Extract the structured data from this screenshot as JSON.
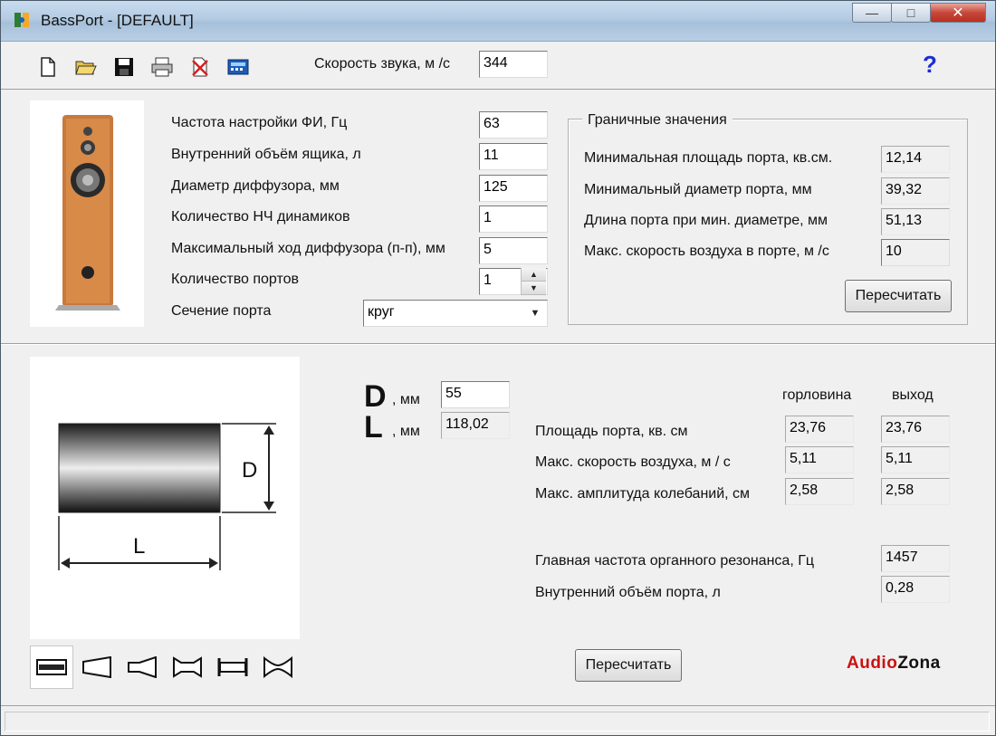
{
  "window": {
    "title": "BassPort - [DEFAULT]",
    "controls": {
      "minimize": "—",
      "maximize": "□",
      "close": "✕"
    }
  },
  "toolbar": {
    "icons": [
      "new-file-icon",
      "open-folder-icon",
      "save-icon",
      "print-icon",
      "delete-icon",
      "calculator-icon"
    ],
    "sound_speed_label": "Скорость звука, м /с",
    "sound_speed_value": "344",
    "help_label": "?"
  },
  "params": {
    "tuning_freq_label": "Частота настройки ФИ, Гц",
    "tuning_freq_value": "63",
    "box_volume_label": "Внутренний объём ящика, л",
    "box_volume_value": "11",
    "cone_diameter_label": "Диаметр диффузора, мм",
    "cone_diameter_value": "125",
    "woofer_count_label": "Количество НЧ динамиков",
    "woofer_count_value": "1",
    "max_excursion_label": "Максимальный ход диффузора (п-п), мм",
    "max_excursion_value": "5",
    "port_count_label": "Количество портов",
    "port_count_value": "1",
    "port_section_label": "Сечение порта",
    "port_section_value": "круг"
  },
  "limits": {
    "title": "Граничные значения",
    "min_area_label": "Минимальная площадь порта, кв.см.",
    "min_area_value": "12,14",
    "min_diameter_label": "Минимальный диаметр порта, мм",
    "min_diameter_value": "39,32",
    "length_at_min_label": "Длина порта при мин. диаметре, мм",
    "length_at_min_value": "51,13",
    "max_air_speed_label": "Макс. скорость воздуха в порте, м /с",
    "max_air_speed_value": "10",
    "recalc_label": "Пересчитать"
  },
  "port": {
    "d_letter": "D",
    "d_unit": ", мм",
    "d_value": "55",
    "l_letter": "L",
    "l_unit": ", мм",
    "l_value": "118,02",
    "diagram_d": "D",
    "diagram_l": "L"
  },
  "results": {
    "col_throat": "горловина",
    "col_exit": "выход",
    "area_label": "Площадь порта, кв. см",
    "area_throat": "23,76",
    "area_exit": "23,76",
    "air_speed_label": "Макс. скорость воздуха, м / с",
    "air_speed_throat": "5,11",
    "air_speed_exit": "5,11",
    "amplitude_label": "Макс. амплитуда колебаний, см",
    "amplitude_throat": "2,58",
    "amplitude_exit": "2,58",
    "organ_freq_label": "Главная частота органного резонанса, Гц",
    "organ_freq_value": "1457",
    "port_volume_label": "Внутренний объём порта, л",
    "port_volume_value": "0,28",
    "recalc_label": "Пересчитать"
  },
  "shape_tabs": [
    "straight-tube-icon",
    "cone-port-icon",
    "horn-port-icon",
    "double-flare-icon",
    "flanged-tube-icon",
    "double-flared-tube-icon"
  ],
  "logo": {
    "part1": "Audio",
    "part2": "Zona",
    "color1": "#cc1111",
    "color2": "#111111"
  }
}
